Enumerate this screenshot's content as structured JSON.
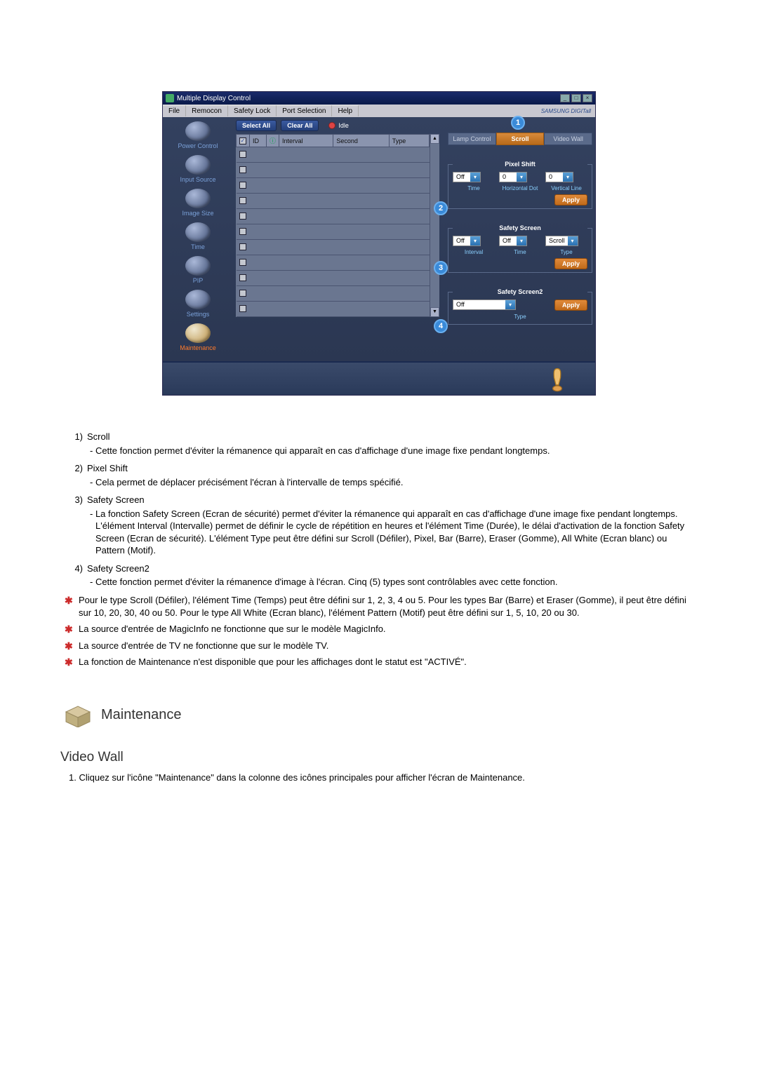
{
  "app": {
    "title": "Multiple Display Control",
    "brand": "SAMSUNG DIGITall",
    "menus": [
      "File",
      "Remocon",
      "Safety Lock",
      "Port Selection",
      "Help"
    ]
  },
  "sidebar": {
    "items": [
      {
        "label": "Power Control"
      },
      {
        "label": "Input Source"
      },
      {
        "label": "Image Size"
      },
      {
        "label": "Time"
      },
      {
        "label": "PIP"
      },
      {
        "label": "Settings"
      },
      {
        "label": "Maintenance"
      }
    ]
  },
  "toolbar": {
    "select_all": "Select All",
    "clear_all": "Clear All",
    "idle": "Idle"
  },
  "grid": {
    "headers": [
      "",
      "ID",
      "",
      "Interval",
      "Second",
      "Type"
    ]
  },
  "tabs": {
    "a": "Lamp Control",
    "b": "Scroll",
    "c": "Video Wall"
  },
  "pixel_shift": {
    "legend": "Pixel Shift",
    "time_val": "Off",
    "hdot_val": "0",
    "vline_val": "0",
    "time_lbl": "Time",
    "hdot_lbl": "Horizontal Dot",
    "vline_lbl": "Vertical Line",
    "apply": "Apply"
  },
  "safety_screen": {
    "legend": "Safety Screen",
    "interval_val": "Off",
    "time_val": "Off",
    "type_val": "Scroll",
    "interval_lbl": "Interval",
    "time_lbl": "Time",
    "type_lbl": "Type",
    "apply": "Apply"
  },
  "safety_screen2": {
    "legend": "Safety Screen2",
    "type_val": "Off",
    "type_lbl": "Type",
    "apply": "Apply"
  },
  "doc": {
    "items": [
      {
        "num": "1)",
        "title": "Scroll",
        "body": "- Cette fonction permet d'éviter la rémanence qui apparaît en cas d'affichage d'une image fixe pendant longtemps."
      },
      {
        "num": "2)",
        "title": "Pixel Shift",
        "body": "- Cela permet de déplacer précisément l'écran à l'intervalle de temps spécifié."
      },
      {
        "num": "3)",
        "title": "Safety Screen",
        "body": "- La fonction Safety Screen (Ecran de sécurité) permet d'éviter la rémanence qui apparaît en cas d'affichage d'une image fixe pendant longtemps. L'élément Interval (Intervalle) permet de définir le cycle de répétition en heures et l'élément Time (Durée), le délai d'activation de la fonction Safety Screen (Ecran de sécurité). L'élément Type peut être défini sur Scroll (Défiler), Pixel, Bar (Barre), Eraser (Gomme), All White (Ecran blanc) ou Pattern (Motif)."
      },
      {
        "num": "4)",
        "title": "Safety Screen2",
        "body": "- Cette fonction permet d'éviter la rémanence d'image à l'écran. Cinq (5) types sont contrôlables avec cette fonction."
      }
    ],
    "stars": [
      "Pour le type Scroll (Défiler), l'élément Time (Temps) peut être défini sur 1, 2, 3, 4 ou 5. Pour les types Bar (Barre) et Eraser (Gomme), il peut être défini sur 10, 20, 30, 40 ou 50. Pour le type All White (Ecran blanc), l'élément Pattern (Motif) peut être défini sur 1, 5, 10, 20 ou 30.",
      "La source d'entrée de MagicInfo ne fonctionne que sur le modèle MagicInfo.",
      "La source d'entrée de TV ne fonctionne que sur le modèle TV.",
      "La fonction de Maintenance n'est disponible que pour les affichages dont le statut est \"ACTIVÉ\"."
    ],
    "section_maintenance": "Maintenance",
    "section_videowall": "Video Wall",
    "vw_step1": "1.  Cliquez sur l'icône \"Maintenance\" dans la colonne des icônes principales pour afficher l'écran de Maintenance."
  }
}
